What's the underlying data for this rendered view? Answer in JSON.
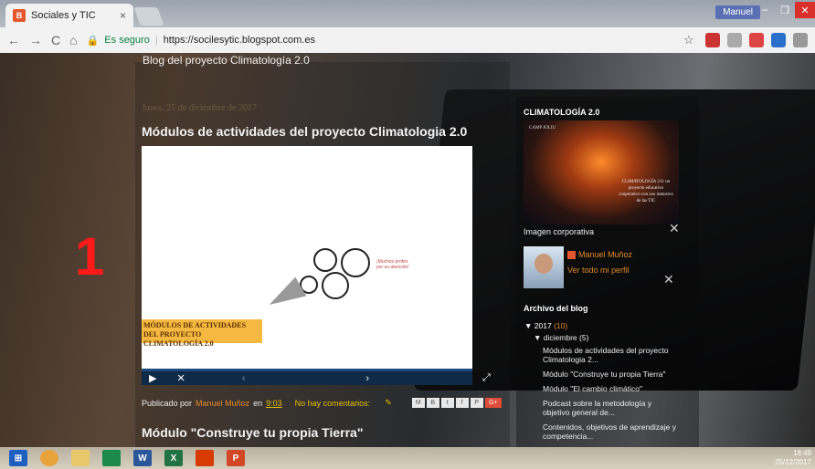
{
  "browser": {
    "tab_title": "Sociales y TIC",
    "tab_close": "×",
    "profile_name": "Manuel",
    "security_label": "Es seguro",
    "url": "https://socilesytic.blogspot.com.es",
    "window_buttons": [
      "–",
      "❐",
      "✕"
    ]
  },
  "blog": {
    "title": "Blog del proyecto Climatología 2.0",
    "overlay_number": "1",
    "post1": {
      "date": "lunes, 25 de diciembre de 2017",
      "title": "Módulos de actividades del proyecto Climatologia 2.0",
      "prezi_banner": "MÓDULOS DE ACTIVIDADES DEL PROYECTO CLIMATOLOGÍA 2.0",
      "prezi_text": "¡Muchos profes por su atención!",
      "posted_by": "Publicado por",
      "author": "Manuel Muñoz",
      "at": "en",
      "time": "9:03",
      "comments": "No hay comentarios:",
      "gplus": "G+"
    },
    "post2": {
      "title": "Módulo \"Construye tu propia Tierra\""
    }
  },
  "sidebar": {
    "section1_title": "CLIMATOLOGÍA 2.0",
    "image_top_text": "CAMP JOLIU",
    "image_text": "CLIMATOLOGÍA 2.0: un proyecto educativo cooperativo con uso intensivo de las TIC",
    "image_caption": "Imagen corporativa",
    "profile_name": "Manuel Muñoz",
    "profile_link": "Ver todo mi perfil",
    "archive_title": "Archivo del blog",
    "year": "2017",
    "year_count": "(10)",
    "month": "diciembre",
    "month_count": "(5)",
    "items": [
      "Módulos de actividades del proyecto Climatologia 2...",
      "Módulo \"Construye tu propia Tierra\"",
      "Módulo \"El cambio climático\"",
      "Podcast sobre la metodología y objetivo general de...",
      "Contenidos, objetivos de aprendizaje y competencia..."
    ]
  },
  "taskbar": {
    "time": "18:49",
    "date": "25/12/2017"
  }
}
